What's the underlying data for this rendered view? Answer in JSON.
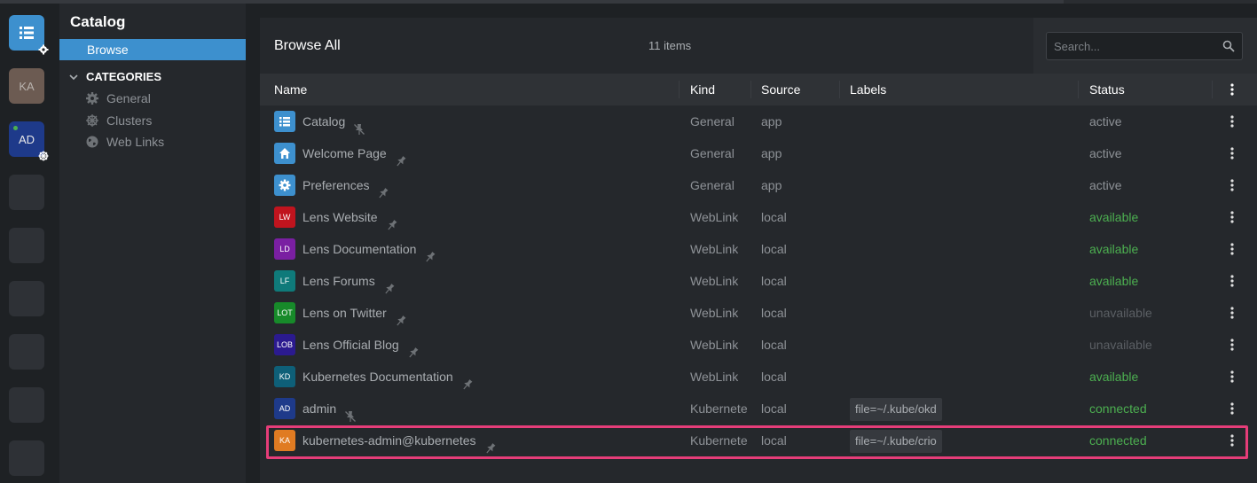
{
  "hotbar": {
    "items": [
      {
        "type": "catalog",
        "label": ""
      },
      {
        "type": "avatar",
        "label": "KA"
      },
      {
        "type": "avatar",
        "label": "AD"
      }
    ],
    "empty_slots": 6
  },
  "sidebar": {
    "title": "Catalog",
    "browse_label": "Browse",
    "categories_label": "CATEGORIES",
    "categories": [
      {
        "label": "General",
        "icon": "gear-icon"
      },
      {
        "label": "Clusters",
        "icon": "helm-icon"
      },
      {
        "label": "Web Links",
        "icon": "globe-icon"
      }
    ]
  },
  "header": {
    "title": "Browse All",
    "count": "11 items",
    "search_placeholder": "Search..."
  },
  "table": {
    "columns": [
      "Name",
      "Kind",
      "Source",
      "Labels",
      "Status"
    ],
    "rows": [
      {
        "icon_text": "",
        "icon_type": "catalog",
        "icon_color": "#3d90ce",
        "name": "Catalog",
        "pinned": true,
        "kind": "General",
        "source": "app",
        "labels": "",
        "status": "active"
      },
      {
        "icon_text": "",
        "icon_type": "home",
        "icon_color": "#3d90ce",
        "name": "Welcome Page",
        "pinned": false,
        "kind": "General",
        "source": "app",
        "labels": "",
        "status": "active"
      },
      {
        "icon_text": "",
        "icon_type": "gear",
        "icon_color": "#3d90ce",
        "name": "Preferences",
        "pinned": false,
        "kind": "General",
        "source": "app",
        "labels": "",
        "status": "active"
      },
      {
        "icon_text": "LW",
        "icon_type": "text",
        "icon_color": "#c0141e",
        "name": "Lens Website",
        "pinned": false,
        "kind": "WebLink",
        "source": "local",
        "labels": "",
        "status": "available"
      },
      {
        "icon_text": "LD",
        "icon_type": "text",
        "icon_color": "#7a1fa2",
        "name": "Lens Documentation",
        "pinned": false,
        "kind": "WebLink",
        "source": "local",
        "labels": "",
        "status": "available"
      },
      {
        "icon_text": "LF",
        "icon_type": "text",
        "icon_color": "#0f7a7a",
        "name": "Lens Forums",
        "pinned": false,
        "kind": "WebLink",
        "source": "local",
        "labels": "",
        "status": "available"
      },
      {
        "icon_text": "LOT",
        "icon_type": "text",
        "icon_color": "#178a2a",
        "name": "Lens on Twitter",
        "pinned": false,
        "kind": "WebLink",
        "source": "local",
        "labels": "",
        "status": "unavailable"
      },
      {
        "icon_text": "LOB",
        "icon_type": "text",
        "icon_color": "#2b1a8f",
        "name": "Lens Official Blog",
        "pinned": false,
        "kind": "WebLink",
        "source": "local",
        "labels": "",
        "status": "unavailable"
      },
      {
        "icon_text": "KD",
        "icon_type": "text",
        "icon_color": "#0e5f78",
        "name": "Kubernetes Documentation",
        "pinned": false,
        "kind": "WebLink",
        "source": "local",
        "labels": "",
        "status": "available"
      },
      {
        "icon_text": "AD",
        "icon_type": "text",
        "icon_color": "#1e3a8a",
        "name": "admin",
        "pinned": true,
        "kind": "Kubernete",
        "source": "local",
        "labels": "file=~/.kube/okd",
        "status": "connected"
      },
      {
        "icon_text": "KA",
        "icon_type": "text",
        "icon_color": "#e07b22",
        "name": "kubernetes-admin@kubernetes",
        "pinned": false,
        "kind": "Kubernete",
        "source": "local",
        "labels": "file=~/.kube/crio",
        "status": "connected"
      }
    ]
  }
}
